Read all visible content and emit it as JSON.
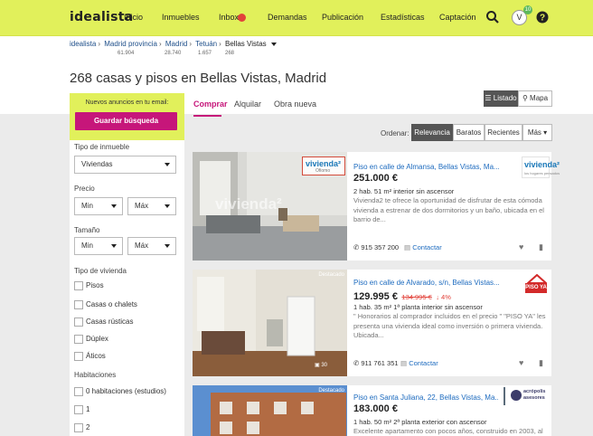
{
  "topbar": {
    "logo": "idealista",
    "nav": [
      "Inicio",
      "Inmuebles",
      "Inbox",
      "Demandas",
      "Publicación",
      "Estadísticas",
      "Captación"
    ],
    "inbox_badge": "",
    "avatar": "V",
    "avatar_badge": "10",
    "colors": {
      "bar": "#e1f05b",
      "accent": "#c6167a"
    }
  },
  "breadcrumb": {
    "items": [
      "idealista",
      "Madrid provincia",
      "Madrid",
      "Tetuán",
      "Bellas Vistas"
    ],
    "counts": [
      "61.904",
      "28.740",
      "1.657",
      "268"
    ]
  },
  "page_title": "268 casas y pisos en Bellas Vistas, Madrid",
  "sidebar": {
    "alert_text": "Nuevos anuncios en tu email:",
    "save_label": "Guardar búsqueda",
    "tipo_inmueble_label": "Tipo de inmueble",
    "tipo_inmueble_value": "Viviendas",
    "precio_label": "Precio",
    "precio_min": "Min",
    "precio_max": "Máx",
    "tamano_label": "Tamaño",
    "tamano_min": "Min",
    "tamano_max": "Máx",
    "tipo_vivienda_label": "Tipo de vivienda",
    "tipo_vivienda_options": [
      "Pisos",
      "Casas o chalets",
      "Casas rústicas",
      "Dúplex",
      "Áticos"
    ],
    "habitaciones_label": "Habitaciones",
    "habitaciones_options": [
      "0 habitaciones (estudios)",
      "1",
      "2"
    ]
  },
  "tabs": [
    "Comprar",
    "Alquilar",
    "Obra nueva"
  ],
  "view": {
    "listado": "Listado",
    "mapa": "Mapa"
  },
  "sort": {
    "label": "Ordenar:",
    "options": [
      "Relevancia",
      "Baratos",
      "Recientes",
      "Más"
    ]
  },
  "listings": [
    {
      "title": "Piso en calle de Almansa, Bellas Vistas, Ma...",
      "price": "251.000 €",
      "old_price": "",
      "drop": "",
      "details": "2 hab.  51 m²  interior sin ascensor",
      "desc": "Vivienda2 te ofrece la oportunidad de disfrutar de esta cómoda vivienda a estrenar de dos dormitorios y un baño, ubicada en el barrio de...",
      "phone": "915 357 200",
      "contact": "Contactar",
      "agency": "vivienda²",
      "agency_sub": "los hogares pensados",
      "photo_mark": "vivienda²",
      "photo_mark2": "Ofiomo",
      "badge": ""
    },
    {
      "title": "Piso en calle de Alvarado, s/n, Bellas Vistas...",
      "price": "129.995 €",
      "old_price": "134.995 €",
      "drop": "↓ 4%",
      "details": "1 hab.  35 m²  1ª planta interior sin ascensor",
      "desc": "\" Honorarios al comprador incluidos en el precio \" \"PISO YA\" les presenta una vivienda ideal como inversión o primera vivienda. Ubicada...",
      "phone": "911 761 351",
      "contact": "Contactar",
      "agency": "PISO YA",
      "agency_sub": "",
      "photo_mark": "",
      "photo_mark2": "",
      "badge": "Destacado",
      "photo_count": "30"
    },
    {
      "title": "Piso en Santa Juliana, 22, Bellas Vistas, Ma...",
      "price": "183.000 €",
      "old_price": "",
      "drop": "",
      "details": "1 hab.  50 m²  2ª planta exterior con ascensor",
      "desc": "Excelente apartamento con pocos años, construido en 2003, al",
      "phone": "",
      "contact": "",
      "agency": "acrópolis asesores",
      "agency_sub": "",
      "photo_mark": "",
      "photo_mark2": "",
      "badge": "Destacado"
    }
  ]
}
